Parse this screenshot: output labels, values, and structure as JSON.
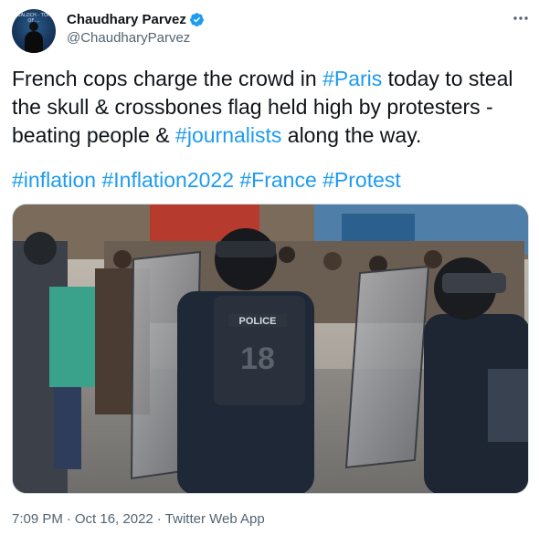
{
  "author": {
    "display_name": "Chaudhary Parvez",
    "handle": "@ChaudharyParvez",
    "avatar_text": "BALOCH - TOP OF ..."
  },
  "tweet": {
    "text_parts": [
      "French cops charge the crowd in ",
      "#Paris",
      " today to steal the skull & crossbones flag held high by protesters - beating people & ",
      "#journalists",
      " along the way."
    ],
    "hashtags": [
      "#inflation",
      "#Inflation2022",
      "#France",
      "#Protest"
    ]
  },
  "media": {
    "vest_text": "POLICE",
    "vest_number": "18"
  },
  "footer": {
    "time": "7:09 PM",
    "separator": "·",
    "date": "Oct 16, 2022",
    "source": "Twitter Web App"
  },
  "colors": {
    "link": "#1d9bf0",
    "secondary": "#536471",
    "verified": "#1d9bf0"
  },
  "icons": {
    "verified": "verified-badge-icon",
    "more": "more-dots-icon"
  }
}
